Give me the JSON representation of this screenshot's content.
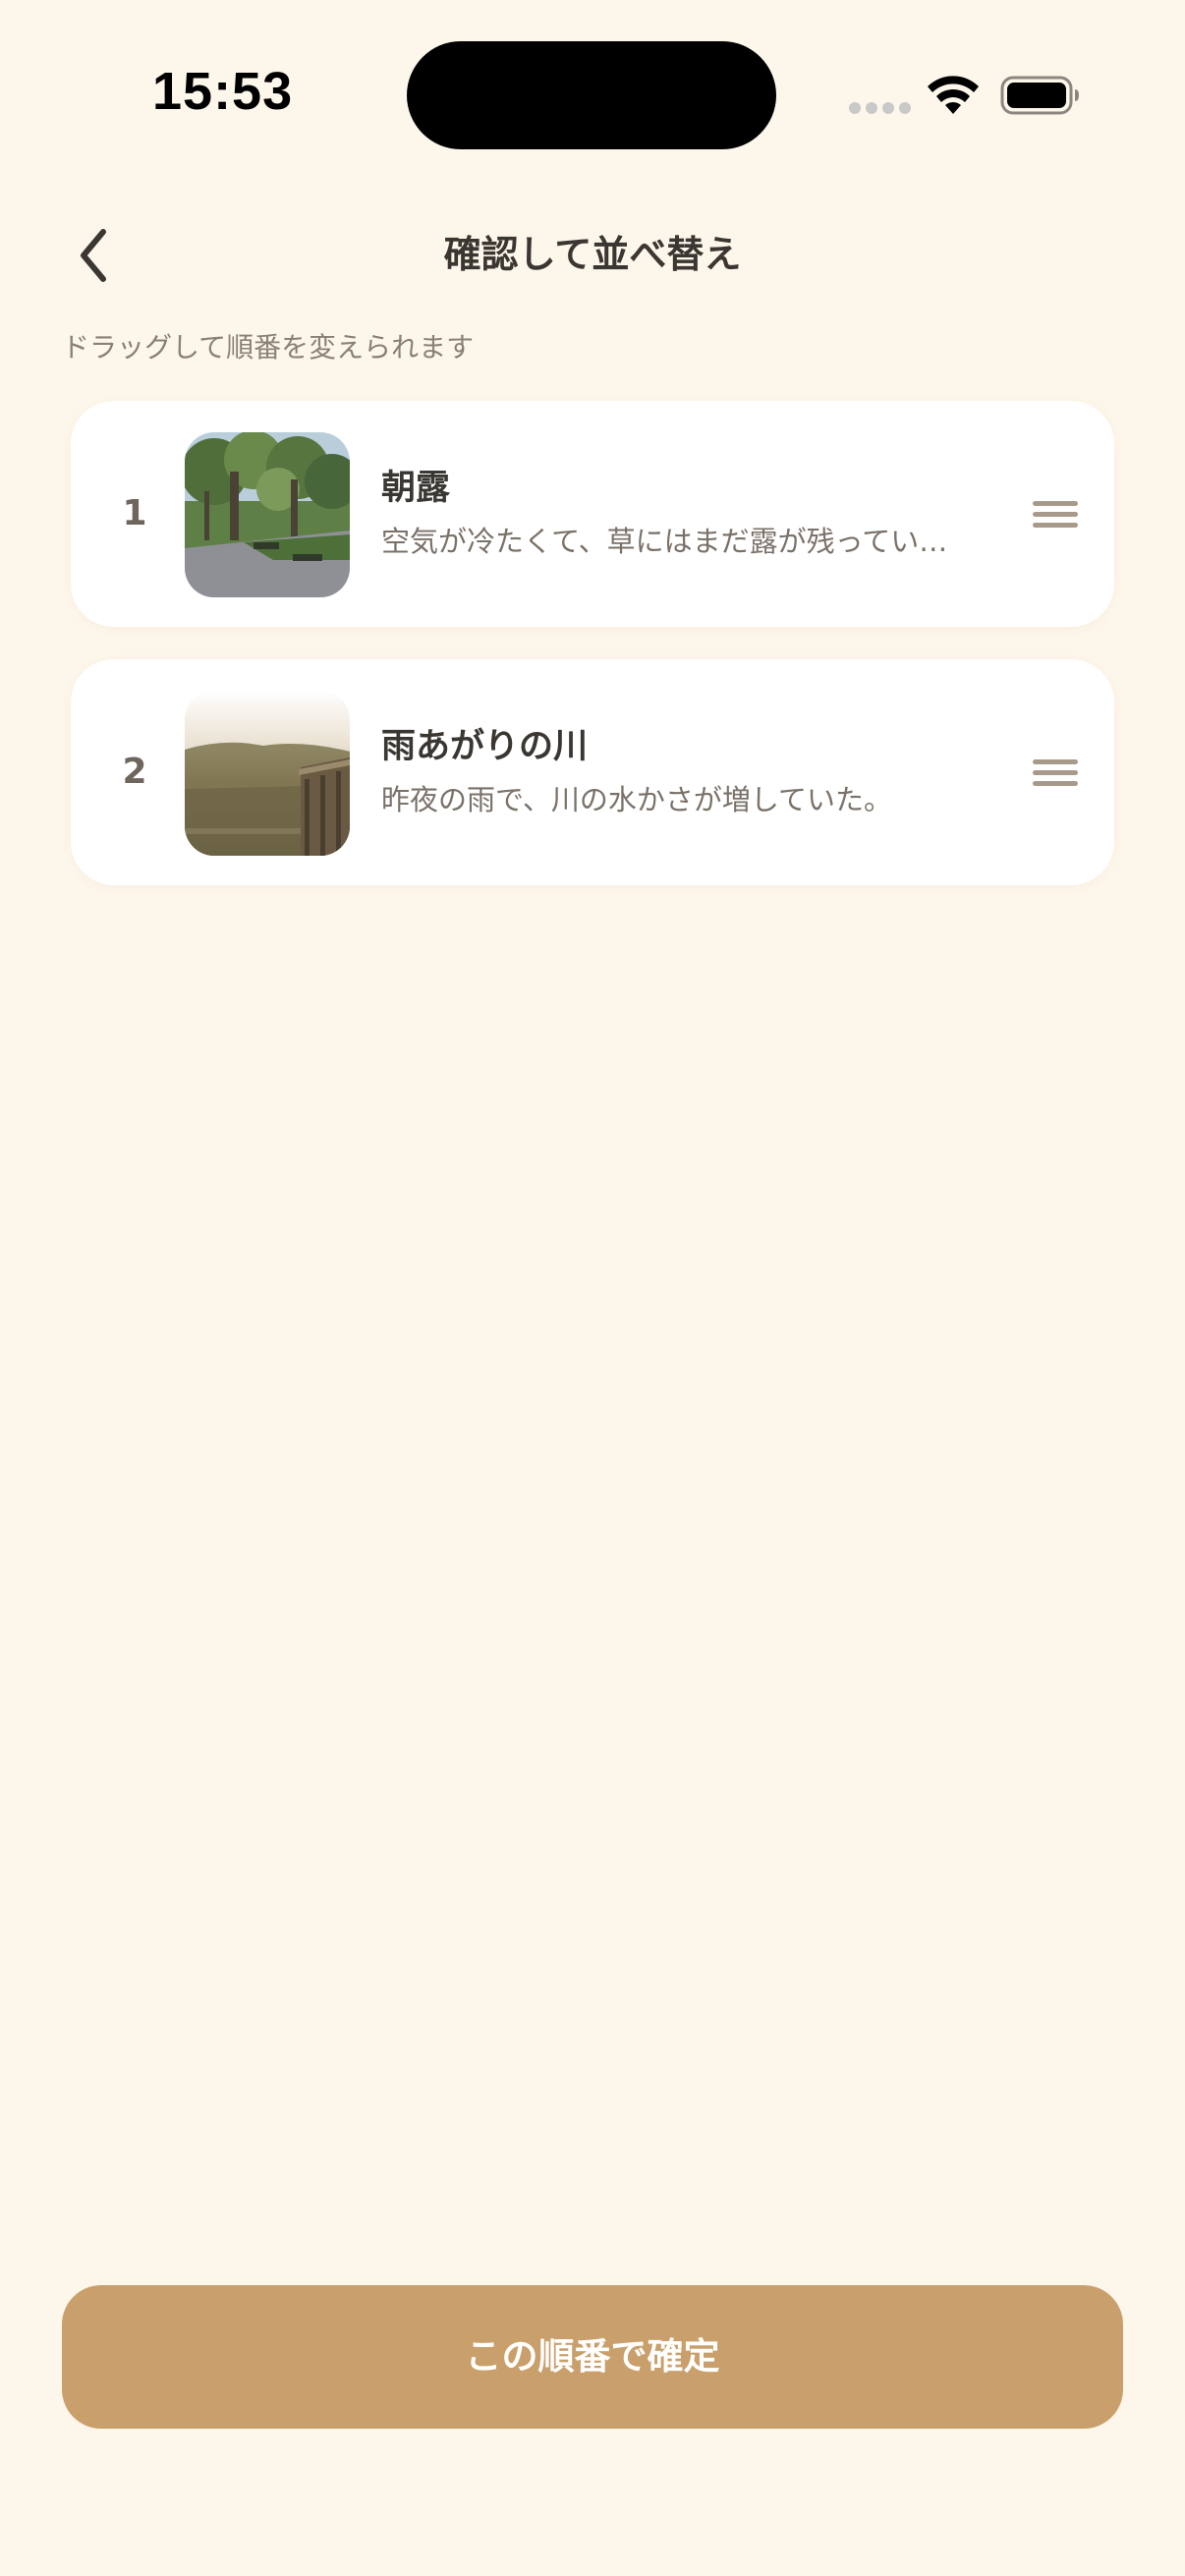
{
  "status_bar": {
    "time": "15:53",
    "icons": [
      "cellular-signal-icon",
      "wifi-icon",
      "battery-icon"
    ]
  },
  "header": {
    "back_icon": "chevron-left-icon",
    "title": "確認して並べ替え"
  },
  "hint": "ドラッグして順番を変えられます",
  "items": [
    {
      "index": "1",
      "title": "朝露",
      "description": "空気が冷たくて、草にはまだ露が残ってい…",
      "thumbnail": "park-trees-photo",
      "handle_icon": "drag-handle-icon"
    },
    {
      "index": "2",
      "title": "雨あがりの川",
      "description": "昨夜の雨で、川の水かさが増していた。",
      "thumbnail": "misty-river-photo",
      "handle_icon": "drag-handle-icon"
    }
  ],
  "confirm_button": {
    "label": "この順番で確定"
  },
  "colors": {
    "background": "#FDF6EA",
    "card": "#FFFFFF",
    "accent": "#C9A06B",
    "text_primary": "#3A3632",
    "text_secondary": "#7A7168",
    "handle": "#A79A8B"
  }
}
